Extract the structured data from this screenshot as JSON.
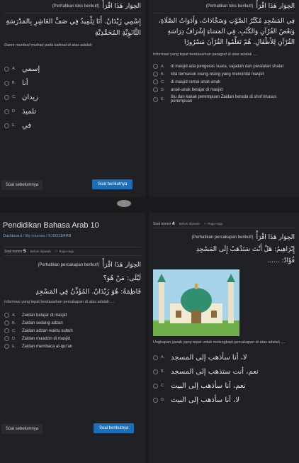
{
  "tl": {
    "header_ar": "الحِوَار هَذَا اقْرَأْ",
    "header_lat": "(Perhatikan teks berikut!)",
    "passage": "إِسْمِي زَيْدَانٌ. أَنَا تِلْمِيذٌ فِي صَفِّ العَاشِرِ بِالمَدْرَسَةِ الثَّانَوِيَّةِ المُحَمَّدِيَّةِ",
    "question": "Damir munfasil mufrad pada kalimat di atas adalah",
    "options": [
      {
        "letter": "A.",
        "text": "إسمي"
      },
      {
        "letter": "B.",
        "text": "أنا"
      },
      {
        "letter": "C.",
        "text": "زيدان"
      },
      {
        "letter": "D.",
        "text": "تلميذ"
      },
      {
        "letter": "E.",
        "text": "في"
      }
    ],
    "prev": "Soal sebelumnya",
    "next": "Soal berikutnya"
  },
  "tr": {
    "header_ar": "الحِوَار هَذَا اقْرَأْ",
    "header_lat": "(Perhatikan teks berikut!)",
    "passage": "فِي المَسْجِدِ مُكَبِّرُ الصَّوْتِ وَسَجَّادَاتٌ، وَأَدَوَاتُ الصَّلَاةِ، وَبَعْضُ القُرْآنِ وَالكُتُبِ. فِي المَسَاءِ إِشْرَافُ دِرَاسَةِ القُرْآنِ لِلأَطْفَالِ. هُمْ تَعَلَّمُوا القُرْآنَ مَسْرُورًا",
    "question": "Informasi yang tepat berdasarkan paragraf di atas adalah ....",
    "options": [
      {
        "letter": "A.",
        "text": "di masjid ada pengeras suara, sajadah dan peralatan shalat"
      },
      {
        "letter": "B.",
        "text": "kita termasuk orang-orang yang mencintai masjid"
      },
      {
        "letter": "C.",
        "text": "di masjid ramai anak-anak"
      },
      {
        "letter": "D.",
        "text": "anak-anak belajar di masjid"
      },
      {
        "letter": "E.",
        "text": "ibu dan kakak perempuan Zaidan berada di shof khusus perempuan"
      }
    ]
  },
  "bl": {
    "course_title": "Pendidikan Bahasa Arab 10",
    "breadcrumb": [
      "Dashboard",
      "My courses",
      "K10G1BARB"
    ],
    "qnum_label": "Soal nomor",
    "qnum": "5",
    "status": "Belum dijawab",
    "flag": "Ragu-ragu",
    "header_ar": "الحِوَار هَذَا اقْرَأْ",
    "header_lat": "(Perhatikan percakapan berikut!)",
    "line1": "لَيْلَى: مَنْ هُوَ؟",
    "line2": "فَاطِمَةُ: هُوَ زَيْدَانٌ. المُؤَذِّنُ فِي المَسْجِدِ",
    "question": "Informasi yang tepat berdasarkan percakapan di atas adalah ....",
    "options": [
      {
        "letter": "A.",
        "text": "Zaidan belajar di masjid"
      },
      {
        "letter": "B.",
        "text": "Zaidan sedang adzan"
      },
      {
        "letter": "C.",
        "text": "Zaidan adzan waktu subuh"
      },
      {
        "letter": "D.",
        "text": "Zaidan muadzin di masjid"
      },
      {
        "letter": "E.",
        "text": "Zaidan membaca al-qur'an"
      }
    ],
    "prev": "Soal sebelumnya",
    "next": "Soal berikutnya"
  },
  "br": {
    "qnum_label": "Soal nomor",
    "qnum": "4",
    "status": "Belum dijawab",
    "flag": "Ragu-ragu",
    "header_ar": "الحِوَار هَذَا اقْرَأْ",
    "header_lat": "(Perhatikan percakapan berikut!)",
    "line1": "إِبْرَاهِيمُ: هَلْ أَنْتَ سَتَذْهَبُ إِلَى المَسْجِدِ",
    "line2": "فُؤَادٌ: ......",
    "question": "Ungkapan jawab yang tepat untuk melengkapi percakapan di atas adalah ....",
    "options": [
      {
        "letter": "A.",
        "text": "لا، أنا سأذهب إلى المسجد"
      },
      {
        "letter": "B.",
        "text": "نعم، أنت ستذهب إلى المسجد"
      },
      {
        "letter": "C.",
        "text": "نعم، أنا سأذهب إلى البيت"
      },
      {
        "letter": "D.",
        "text": "لا، أنا سأذهب إلى البيت"
      }
    ]
  }
}
